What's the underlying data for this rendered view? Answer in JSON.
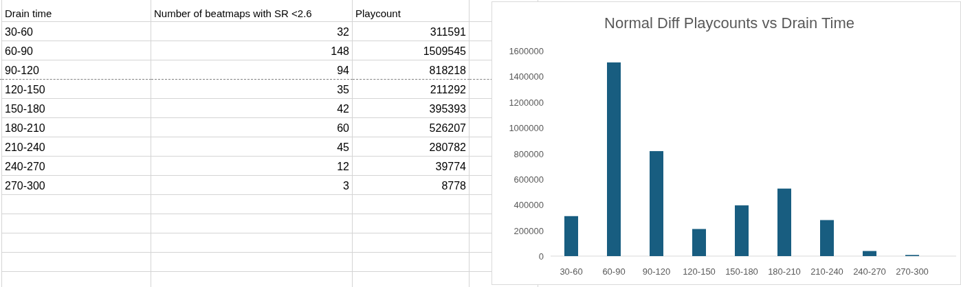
{
  "table": {
    "columns": [
      "Drain time",
      "Number of beatmaps with SR <2.6",
      "Playcount"
    ],
    "rows": [
      [
        "30-60",
        "32",
        "311591"
      ],
      [
        "60-90",
        "148",
        "1509545"
      ],
      [
        "90-120",
        "94",
        "818218"
      ],
      [
        "120-150",
        "35",
        "211292"
      ],
      [
        "150-180",
        "42",
        "395393"
      ],
      [
        "180-210",
        "60",
        "526207"
      ],
      [
        "210-240",
        "45",
        "280782"
      ],
      [
        "240-270",
        "12",
        "39774"
      ],
      [
        "270-300",
        "3",
        "8778"
      ]
    ]
  },
  "chart": {
    "chart_data": {
      "type": "bar",
      "title": "Normal Diff Playcounts vs Drain Time",
      "categories": [
        "30-60",
        "60-90",
        "90-120",
        "120-150",
        "150-180",
        "180-210",
        "210-240",
        "240-270",
        "270-300"
      ],
      "series": [
        {
          "color": "#185d80",
          "values": [
            311591,
            1509545,
            818218,
            211292,
            395393,
            526207,
            280782,
            39774,
            8778
          ]
        }
      ],
      "ylim": [
        0,
        1600000
      ],
      "yticks": [
        0,
        200000,
        400000,
        600000,
        800000,
        1000000,
        1200000,
        1400000,
        1600000
      ]
    }
  }
}
